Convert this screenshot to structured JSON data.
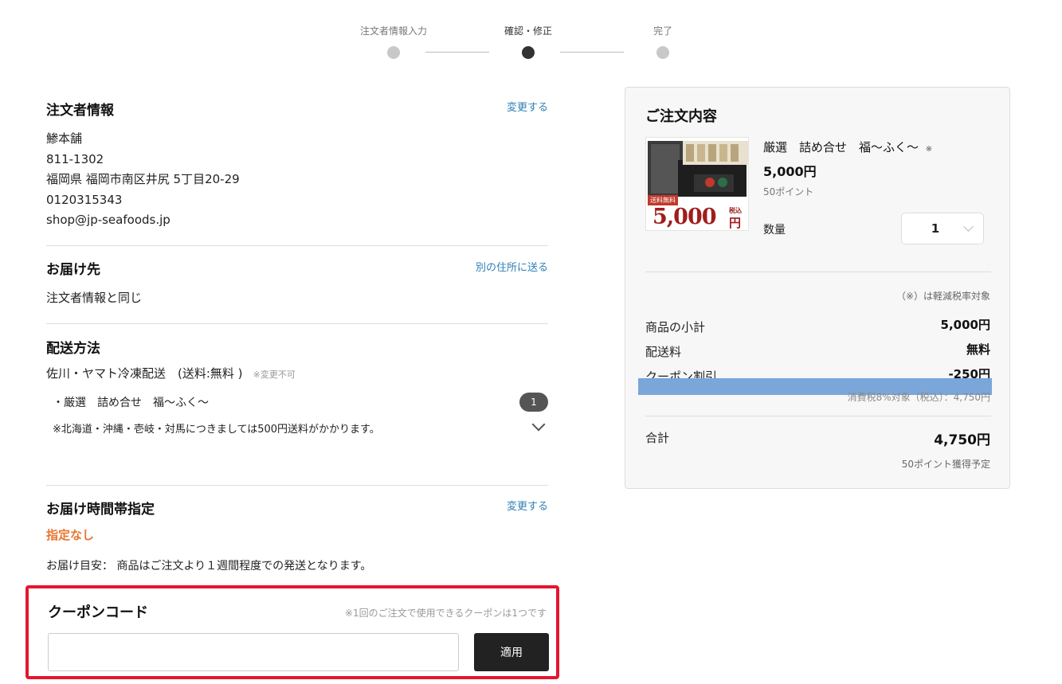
{
  "stepper": {
    "steps": [
      {
        "label": "注文者情報入力",
        "state": "done"
      },
      {
        "label": "確認・修正",
        "state": "active"
      },
      {
        "label": "完了",
        "state": "pending"
      }
    ]
  },
  "orderer": {
    "title": "注文者情報",
    "change_link": "変更する",
    "name": "鯵本舗",
    "zip": "811-1302",
    "address": "福岡県 福岡市南区井尻 5丁目20-29",
    "phone": "0120315343",
    "email": "shop@jp-seafoods.jp"
  },
  "delivery_address": {
    "title": "お届け先",
    "change_link": "別の住所に送る",
    "value": "注文者情報と同じ"
  },
  "shipping": {
    "title": "配送方法",
    "method": "佐川・ヤマト冷凍配送　(送料:無料 )",
    "note": "※変更不可",
    "item": "・厳選　詰め合せ　福～ふく～",
    "item_qty": "1",
    "notice": "※北海道・沖縄・壱岐・対馬につきましては500円送料がかかります。"
  },
  "delivery_time": {
    "title": "お届け時間帯指定",
    "change_link": "変更する",
    "value": "指定なし",
    "estimate": "お届け目安：  商品はご注文より１週間程度での発送となります。"
  },
  "coupon": {
    "title": "クーポンコード",
    "note": "※1回のご注文で使用できるクーポンは1つです",
    "input_value": "",
    "apply_label": "適用"
  },
  "summary": {
    "title": "ご注文内容",
    "product": {
      "name": "厳選　詰め合せ　福～ふく～",
      "name_mark": "※",
      "price": "5,000円",
      "points": "50ポイント",
      "image_badge": "送料無料",
      "image_price": "5,000",
      "image_price_unit": "円",
      "image_tax": "税込"
    },
    "qty_label": "数量",
    "qty_value": "1",
    "reduced_tax_note": "（※）は軽減税率対象",
    "subtotal_label": "商品の小計",
    "subtotal_value": "5,000円",
    "shipping_label": "配送料",
    "shipping_value": "無料",
    "coupon_label": "クーポン割引",
    "coupon_value": "-250円",
    "tax_note": "消費税8%対象（税込）：4,750円",
    "total_label": "合計",
    "total_value": "4,750円",
    "points_note": "50ポイント獲得予定"
  },
  "colors": {
    "accent_link": "#2f7fb6",
    "orange": "#e8742e",
    "coupon_border": "#e4162f",
    "highlight_bar": "#7ba6d9"
  }
}
